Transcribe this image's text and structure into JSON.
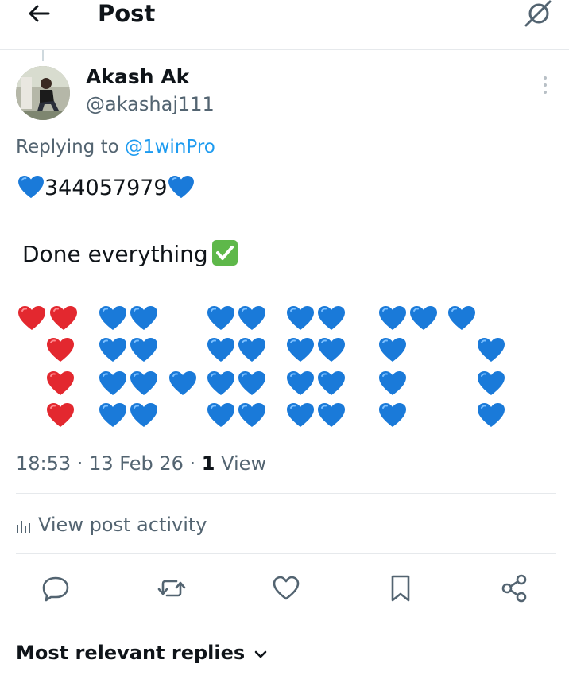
{
  "header": {
    "title": "Post",
    "back_icon": "arrow-left-icon",
    "grok_icon": "grok-icon"
  },
  "post": {
    "author_name": "Akash Ak",
    "author_handle": "@akashaj111",
    "replying_prefix": "Replying to ",
    "replying_mention": "@1winPro",
    "line1_text": "344057979",
    "line2_text": "Done everything",
    "timestamp_time": "18:53",
    "separator": " · ",
    "timestamp_date": "13 Feb 26",
    "view_count": "1",
    "view_label": " View"
  },
  "activity_label": "View post activity",
  "actions": [
    {
      "name": "reply",
      "icon": "reply-icon"
    },
    {
      "name": "repost",
      "icon": "repost-icon"
    },
    {
      "name": "like",
      "icon": "heart-icon"
    },
    {
      "name": "bookmark",
      "icon": "bookmark-icon"
    },
    {
      "name": "share",
      "icon": "share-icon"
    }
  ],
  "replies_sort_label": "Most relevant replies",
  "colors": {
    "accent": "#1d9bf0",
    "secondary_text": "#536471",
    "red_heart": "#e3282f",
    "blue_heart": "#1a7ad9",
    "check_green": "#5eb84a"
  }
}
